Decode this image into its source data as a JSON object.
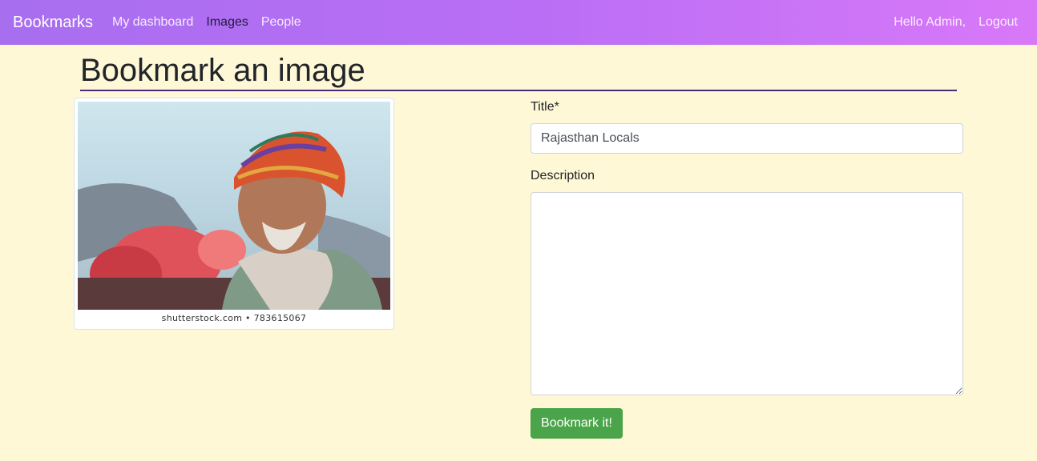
{
  "navbar": {
    "brand": "Bookmarks",
    "links": [
      {
        "label": "My dashboard",
        "active": false
      },
      {
        "label": "Images",
        "active": true
      },
      {
        "label": "People",
        "active": false
      }
    ],
    "greeting": "Hello Admin,",
    "logout_label": "Logout",
    "gradient_colors": [
      "#a86ef0",
      "#d878f8"
    ],
    "active_link_color": "#1f1b3a"
  },
  "page": {
    "title": "Bookmark an image"
  },
  "thumbnail": {
    "caption": "shutterstock.com • 783615067"
  },
  "form": {
    "title_label": "Title*",
    "title_value": "Rajasthan Locals",
    "description_label": "Description",
    "description_value": "",
    "submit_label": "Bookmark it!",
    "submit_color": "#4aa54a"
  }
}
